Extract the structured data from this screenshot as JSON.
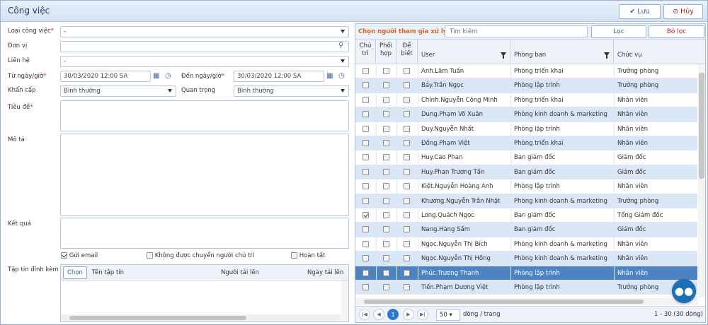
{
  "window": {
    "title": "Công việc",
    "save": "Lưu",
    "cancel": "Hủy"
  },
  "form": {
    "loai_cong_viec": {
      "label": "Loại công việc",
      "value": "-"
    },
    "don_vi": {
      "label": "Đơn vị",
      "value": ""
    },
    "lien_he": {
      "label": "Liên hệ",
      "value": "-"
    },
    "tu_ngay": {
      "label": "Từ ngày/giờ",
      "value": "30/03/2020 12:00 SA"
    },
    "den_ngay": {
      "label": "Đến ngày/giờ",
      "value": "30/03/2020 12:00 SA"
    },
    "khan_cap": {
      "label": "Khẩn cấp",
      "value": "Bình thường"
    },
    "quan_trong": {
      "label": "Quan trọng",
      "value": "Bình thường"
    },
    "tieu_de": {
      "label": "Tiêu đề"
    },
    "mo_ta": {
      "label": "Mô tả"
    },
    "ket_qua": {
      "label": "Kết quả"
    },
    "gui_email": {
      "label": "Gửi email",
      "checked": true
    },
    "khong_chuyen": {
      "label": "Không được chuyển người chủ trì",
      "checked": false
    },
    "hoan_tat": {
      "label": "Hoàn tất",
      "checked": false
    },
    "attachments": {
      "label": "Tập tin đính kèm",
      "choose": "Chọn",
      "cols": [
        "Tên tập tin",
        "Người tải lên",
        "Ngày tải lên"
      ]
    }
  },
  "panel": {
    "title": "Chọn người tham gia xử lý",
    "search_placeholder": "Tìm kiếm",
    "filter": "Lọc",
    "clear": "Bỏ lọc",
    "headers": {
      "chu_tri": "Chủ trì",
      "phoi_hop": "Phối hợp",
      "de_biet": "Để biết",
      "user": "User",
      "phong_ban": "Phòng ban",
      "chuc_vu": "Chức vụ"
    },
    "rows": [
      {
        "user": "Anh.Lâm Tuấn",
        "dept": "Phòng triển khai",
        "pos": "Trưởng phòng",
        "chu": false
      },
      {
        "user": "Bảy.Trần Ngọc",
        "dept": "Phòng lập trình",
        "pos": "Trưởng phòng",
        "chu": false
      },
      {
        "user": "Chính.Nguyễn Công Minh",
        "dept": "Phòng triển khai",
        "pos": "Nhân viên",
        "chu": false
      },
      {
        "user": "Dung.Phạm Võ Xuân",
        "dept": "Phòng kinh doanh & marketing",
        "pos": "Nhân viên",
        "chu": false
      },
      {
        "user": "Duy.Nguyễn Nhất",
        "dept": "Phòng lập trình",
        "pos": "Nhân viên",
        "chu": false
      },
      {
        "user": "Đồng.Phạm Việt",
        "dept": "Phòng triển khai",
        "pos": "Nhân viên",
        "chu": false
      },
      {
        "user": "Huy.Cao Phan",
        "dept": "Ban giám đốc",
        "pos": "Giám đốc",
        "chu": false
      },
      {
        "user": "Huy.Phan Trương Tấn",
        "dept": "Ban giám đốc",
        "pos": "Giám đốc",
        "chu": false
      },
      {
        "user": "Kiệt.Nguyễn Hoàng Anh",
        "dept": "Phòng lập trình",
        "pos": "Nhân viên",
        "chu": false
      },
      {
        "user": "Khương.Nguyễn Trần Nhật",
        "dept": "Phòng kinh doanh & marketing",
        "pos": "Trưởng phòng",
        "chu": false
      },
      {
        "user": "Long.Quách Ngọc",
        "dept": "Ban giám đốc",
        "pos": "Tổng Giám đốc",
        "chu": true
      },
      {
        "user": "Nang.Hàng Sấm",
        "dept": "Ban giám đốc",
        "pos": "Giám đốc",
        "chu": false
      },
      {
        "user": "Ngọc.Nguyễn Thị Bích",
        "dept": "Phòng kinh doanh & marketing",
        "pos": "Nhân viên",
        "chu": false
      },
      {
        "user": "Ngọc.Nguyễn Thị Hồng",
        "dept": "Phòng kinh doanh & marketing",
        "pos": "Nhân viên",
        "chu": false
      },
      {
        "user": "Phúc.Trương Thanh",
        "dept": "Phòng lập trình",
        "pos": "Nhân viên",
        "chu": false
      },
      {
        "user": "Tiến.Phạm Dương Việt",
        "dept": "Phòng lập trình",
        "pos": "Trưởng phòng",
        "chu": false
      }
    ],
    "selected_row": 14,
    "pager": {
      "page": "1",
      "page_size": "50",
      "per_page_label": "dòng / trang",
      "summary": "1 - 30 (30 dòng)"
    }
  }
}
